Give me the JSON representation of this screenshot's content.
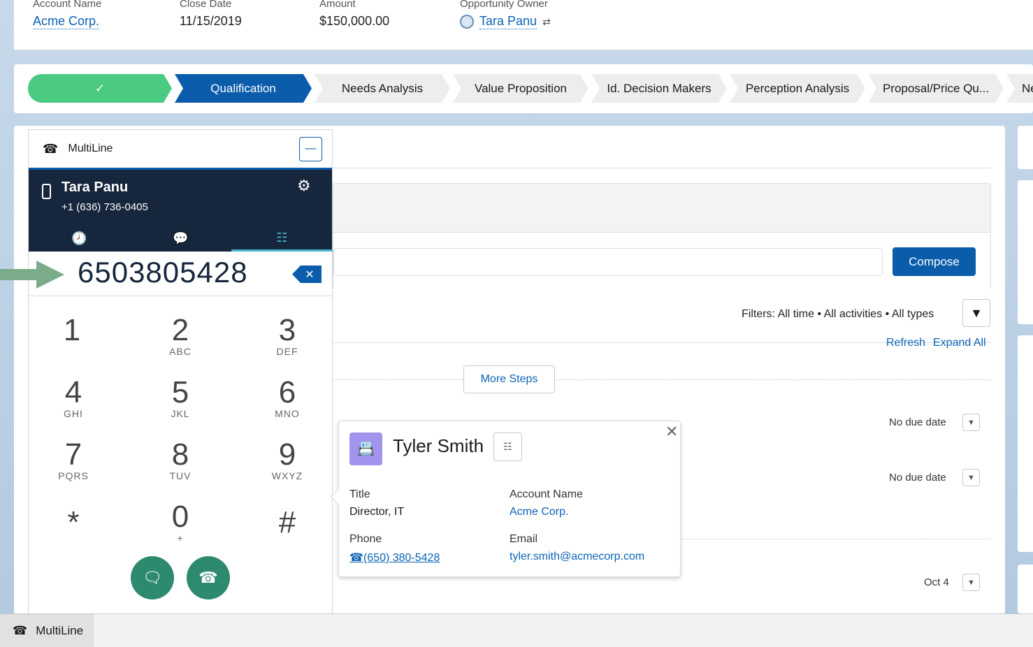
{
  "header": {
    "fields": [
      {
        "label": "Account Name",
        "value": "Acme Corp."
      },
      {
        "label": "Close Date",
        "value": "11/15/2019"
      },
      {
        "label": "Amount",
        "value": "$150,000.00"
      },
      {
        "label": "Opportunity Owner",
        "value": "Tara Panu"
      }
    ]
  },
  "path": {
    "steps": [
      "✓",
      "Qualification",
      "Needs Analysis",
      "Value Proposition",
      "Id. Decision Makers",
      "Perception Analysis",
      "Proposal/Price Qu...",
      "Neg"
    ]
  },
  "activity": {
    "compose_label": "Compose",
    "filters_text": "Filters: All time • All activities • All types",
    "refresh_label": "Refresh",
    "expand_label": "Expand All",
    "more_steps_label": "More Steps",
    "due_1": "No due date",
    "due_2": "No due date",
    "due_3": "Oct 4"
  },
  "softphone": {
    "title": "MultiLine",
    "user_name": "Tara Panu",
    "user_number": "+1 (636) 736-0405",
    "dialed_number": "6503805428",
    "keys": [
      {
        "d": "1",
        "l": ""
      },
      {
        "d": "2",
        "l": "ABC"
      },
      {
        "d": "3",
        "l": "DEF"
      },
      {
        "d": "4",
        "l": "GHI"
      },
      {
        "d": "5",
        "l": "JKL"
      },
      {
        "d": "6",
        "l": "MNO"
      },
      {
        "d": "7",
        "l": "PQRS"
      },
      {
        "d": "8",
        "l": "TUV"
      },
      {
        "d": "9",
        "l": "WXYZ"
      },
      {
        "d": "*",
        "l": ""
      },
      {
        "d": "0",
        "l": "+"
      },
      {
        "d": "#",
        "l": ""
      }
    ]
  },
  "contact_card": {
    "name": "Tyler Smith",
    "title_label": "Title",
    "title_value": "Director, IT",
    "account_label": "Account Name",
    "account_value": "Acme Corp.",
    "phone_label": "Phone",
    "phone_value": "(650) 380-5428",
    "email_label": "Email",
    "email_value": "tyler.smith@acmecorp.com"
  },
  "utility_bar": {
    "item_label": "MultiLine"
  },
  "colors": {
    "brand_blue": "#0b5cab",
    "complete_green": "#4bca81",
    "softphone_dark": "#16263d",
    "call_green": "#2e8a6f",
    "contact_purple": "#a094ed"
  }
}
